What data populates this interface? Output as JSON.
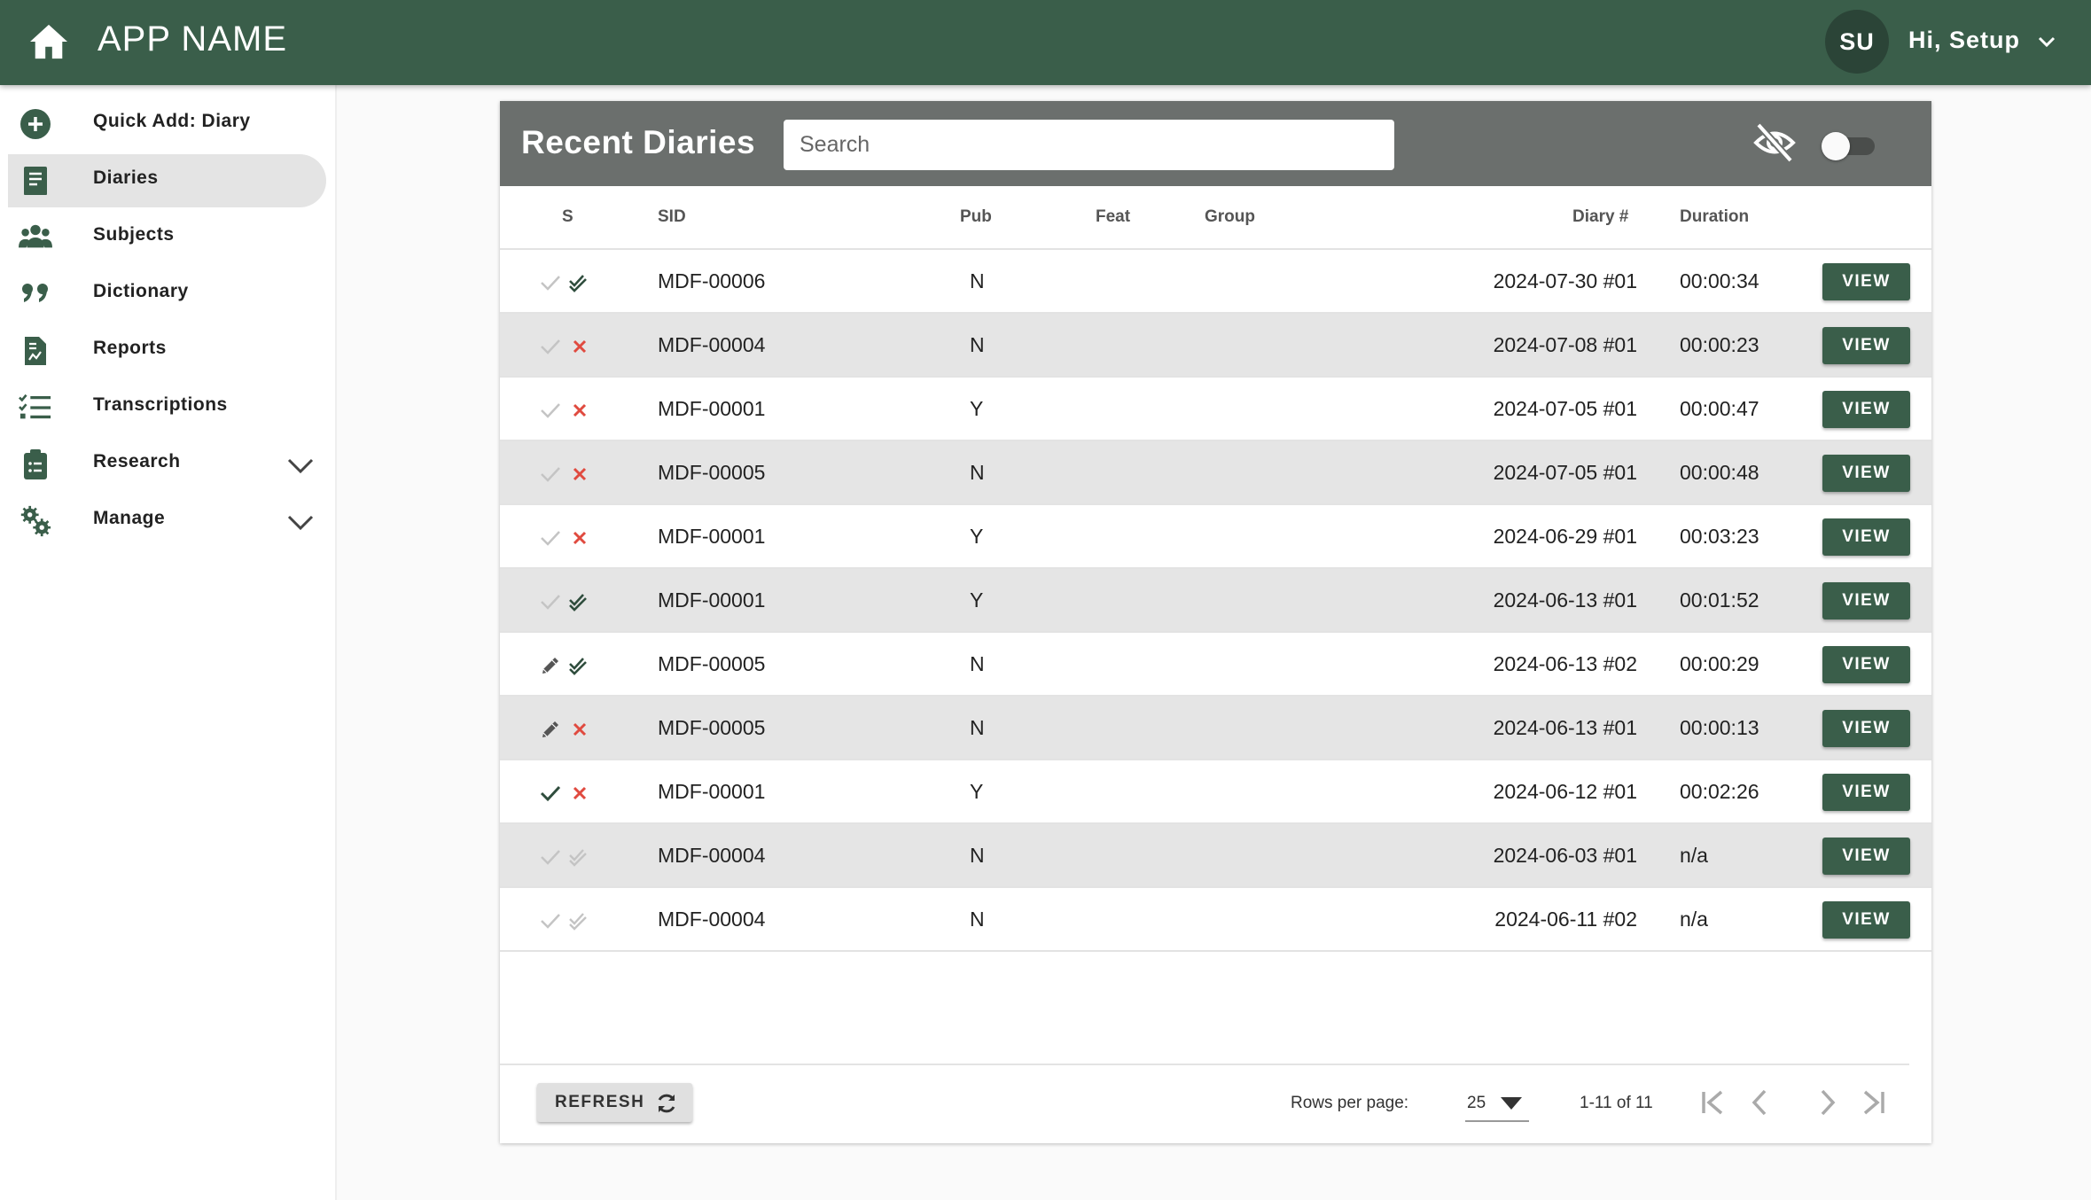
{
  "header": {
    "app_name": "APP NAME",
    "avatar_initials": "SU",
    "greeting": "Hi, Setup",
    "brand_color": "#3a5e4a"
  },
  "sidebar": {
    "items": [
      {
        "label": "Quick Add: Diary",
        "icon": "plus-circle-icon"
      },
      {
        "label": "Diaries",
        "icon": "book-icon",
        "active": true
      },
      {
        "label": "Subjects",
        "icon": "users-icon"
      },
      {
        "label": "Dictionary",
        "icon": "quote-icon"
      },
      {
        "label": "Reports",
        "icon": "report-icon"
      },
      {
        "label": "Transcriptions",
        "icon": "checklist-icon"
      },
      {
        "label": "Research",
        "icon": "clipboard-icon",
        "expandable": true
      },
      {
        "label": "Manage",
        "icon": "gears-icon",
        "expandable": true
      }
    ]
  },
  "card": {
    "title": "Recent Diaries",
    "search_placeholder": "Search",
    "visibility_toggle": "off"
  },
  "table": {
    "columns": {
      "s": "S",
      "sid": "SID",
      "pub": "Pub",
      "feat": "Feat",
      "group": "Group",
      "diary": "Diary #",
      "duration": "Duration"
    },
    "view_label": "VIEW",
    "rows": [
      {
        "status1": "check-light",
        "status2": "double-check-dark",
        "sid": "MDF-00006",
        "pub": "N",
        "diary": "2024-07-30 #01",
        "duration": "00:00:34"
      },
      {
        "status1": "check-light",
        "status2": "x-red",
        "sid": "MDF-00004",
        "pub": "N",
        "diary": "2024-07-08 #01",
        "duration": "00:00:23"
      },
      {
        "status1": "check-light",
        "status2": "x-red",
        "sid": "MDF-00001",
        "pub": "Y",
        "diary": "2024-07-05 #01",
        "duration": "00:00:47"
      },
      {
        "status1": "check-light",
        "status2": "x-red",
        "sid": "MDF-00005",
        "pub": "N",
        "diary": "2024-07-05 #01",
        "duration": "00:00:48"
      },
      {
        "status1": "check-light",
        "status2": "x-red",
        "sid": "MDF-00001",
        "pub": "Y",
        "diary": "2024-06-29 #01",
        "duration": "00:03:23"
      },
      {
        "status1": "check-light",
        "status2": "double-check-dark",
        "sid": "MDF-00001",
        "pub": "Y",
        "diary": "2024-06-13 #01",
        "duration": "00:01:52"
      },
      {
        "status1": "pencil",
        "status2": "double-check-dark",
        "sid": "MDF-00005",
        "pub": "N",
        "diary": "2024-06-13 #02",
        "duration": "00:00:29"
      },
      {
        "status1": "pencil",
        "status2": "x-red",
        "sid": "MDF-00005",
        "pub": "N",
        "diary": "2024-06-13 #01",
        "duration": "00:00:13"
      },
      {
        "status1": "check-dark",
        "status2": "x-red",
        "sid": "MDF-00001",
        "pub": "Y",
        "diary": "2024-06-12 #01",
        "duration": "00:02:26"
      },
      {
        "status1": "check-light",
        "status2": "double-check-light",
        "sid": "MDF-00004",
        "pub": "N",
        "diary": "2024-06-03 #01",
        "duration": "n/a"
      },
      {
        "status1": "check-light",
        "status2": "double-check-light",
        "sid": "MDF-00004",
        "pub": "N",
        "diary": "2024-06-11 #02",
        "duration": "n/a"
      }
    ]
  },
  "footer": {
    "refresh_label": "REFRESH",
    "rows_per_page_label": "Rows per page:",
    "rows_per_page_value": "25",
    "range_text": "1-11 of 11"
  }
}
